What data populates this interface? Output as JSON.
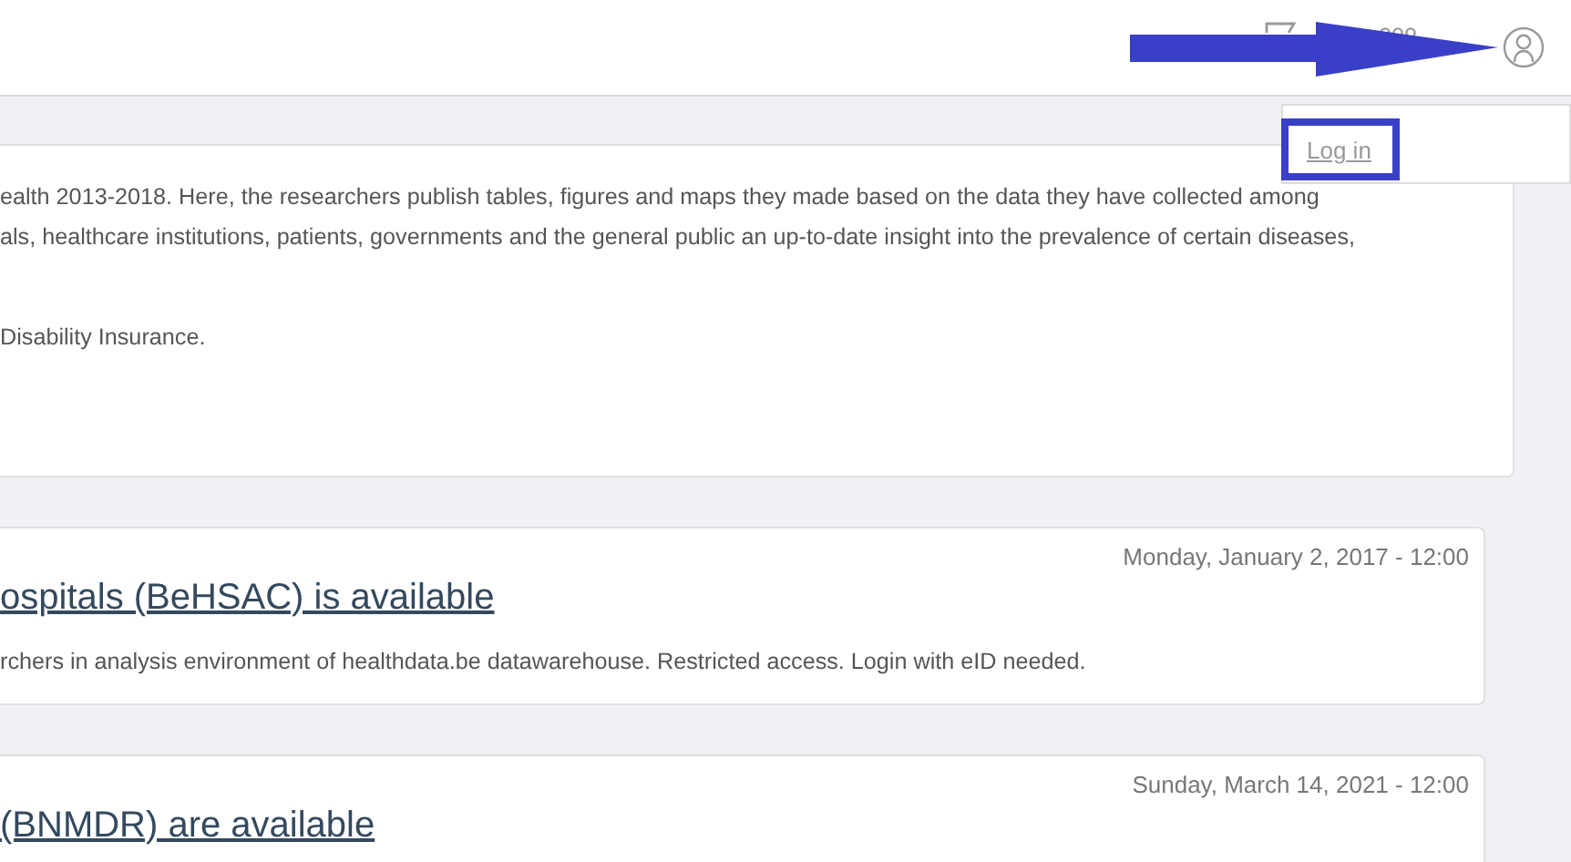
{
  "header": {
    "login_menu": {
      "link": "Log in"
    }
  },
  "news": [
    {
      "paragraphs": [
        [
          "ealth 2013-2018. Here, the researchers publish tables, figures and maps they made based on the data they have collected among",
          "als, healthcare institutions, patients, governments and the general public an up-to-date insight into the prevalence of certain diseases,"
        ],
        [
          "Disability Insurance."
        ]
      ]
    },
    {
      "date": "Monday, January 2, 2017 - 12:00",
      "title": "ospitals (BeHSAC) is available",
      "paragraphs": [
        [
          "rchers in analysis environment of healthdata.be datawarehouse. Restricted access. Login with eID needed."
        ]
      ]
    },
    {
      "date": "Sunday, March 14, 2021 - 12:00",
      "title": "(BNMDR) are available"
    }
  ]
}
